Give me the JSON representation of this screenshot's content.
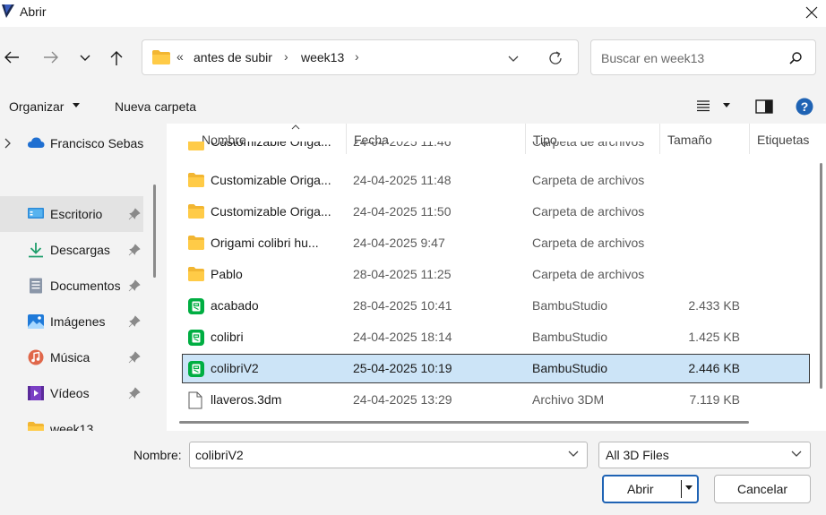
{
  "window": {
    "title": "Abrir",
    "close_icon": "close-icon",
    "app_icon": "app-logo-icon"
  },
  "nav": {
    "back_icon": "arrow-left-icon",
    "forward_icon": "arrow-right-icon",
    "recent_icon": "chevron-down-icon",
    "up_icon": "arrow-up-icon",
    "breadcrumb_overflow": "«",
    "breadcrumb": [
      "antes de subir",
      "week13"
    ],
    "separator": "›",
    "refresh_icon": "refresh-icon"
  },
  "search": {
    "placeholder": "Buscar en week13"
  },
  "toolbar": {
    "organize_label": "Organizar",
    "new_folder_label": "Nueva carpeta",
    "help_color": "#1f63b4"
  },
  "sidebar": {
    "items": [
      {
        "label": "Francisco Sebas",
        "icon": "cloud-icon",
        "pinned": false
      },
      {
        "label": "Escritorio",
        "icon": "desktop-icon",
        "pinned": true,
        "selected": true
      },
      {
        "label": "Descargas",
        "icon": "download-icon",
        "pinned": true
      },
      {
        "label": "Documentos",
        "icon": "document-icon",
        "pinned": true
      },
      {
        "label": "Imágenes",
        "icon": "image-icon",
        "pinned": true
      },
      {
        "label": "Música",
        "icon": "music-icon",
        "pinned": true
      },
      {
        "label": "Vídeos",
        "icon": "video-icon",
        "pinned": true
      },
      {
        "label": "week13",
        "icon": "folder-icon",
        "pinned": false
      }
    ]
  },
  "filelist": {
    "columns": [
      "Nombre",
      "Fecha",
      "Tipo",
      "Tamaño",
      "Etiquetas"
    ],
    "partial_row": {
      "name": "Customizable Origa...",
      "date": "24-04-2025 11:46",
      "type": "Carpeta de archivos"
    },
    "rows": [
      {
        "name": "Customizable Origa...",
        "date": "24-04-2025 11:48",
        "type": "Carpeta de archivos",
        "size": "",
        "icon": "folder-icon"
      },
      {
        "name": "Customizable Origa...",
        "date": "24-04-2025 11:50",
        "type": "Carpeta de archivos",
        "size": "",
        "icon": "folder-icon"
      },
      {
        "name": "Origami colibri hu...",
        "date": "24-04-2025 9:47",
        "type": "Carpeta de archivos",
        "size": "",
        "icon": "folder-icon"
      },
      {
        "name": "Pablo",
        "date": "28-04-2025 11:25",
        "type": "Carpeta de archivos",
        "size": "",
        "icon": "folder-icon"
      },
      {
        "name": "acabado",
        "date": "28-04-2025 10:41",
        "type": "BambuStudio",
        "size": "2.433 KB",
        "icon": "bambustudio-file-icon"
      },
      {
        "name": "colibri",
        "date": "24-04-2025 18:14",
        "type": "BambuStudio",
        "size": "1.425 KB",
        "icon": "bambustudio-file-icon"
      },
      {
        "name": "colibriV2",
        "date": "25-04-2025 10:19",
        "type": "BambuStudio",
        "size": "2.446 KB",
        "icon": "bambustudio-file-icon",
        "selected": true
      },
      {
        "name": "llaveros.3dm",
        "date": "24-04-2025 13:29",
        "type": "Archivo 3DM",
        "size": "7.119 KB",
        "icon": "generic-file-icon"
      }
    ]
  },
  "footer": {
    "filename_label": "Nombre:",
    "filename_value": "colibriV2",
    "filter_value": "All 3D Files",
    "open_label": "Abrir",
    "cancel_label": "Cancelar",
    "accent_color": "#1f63b4",
    "selected_row_color": "#cce4f7"
  }
}
